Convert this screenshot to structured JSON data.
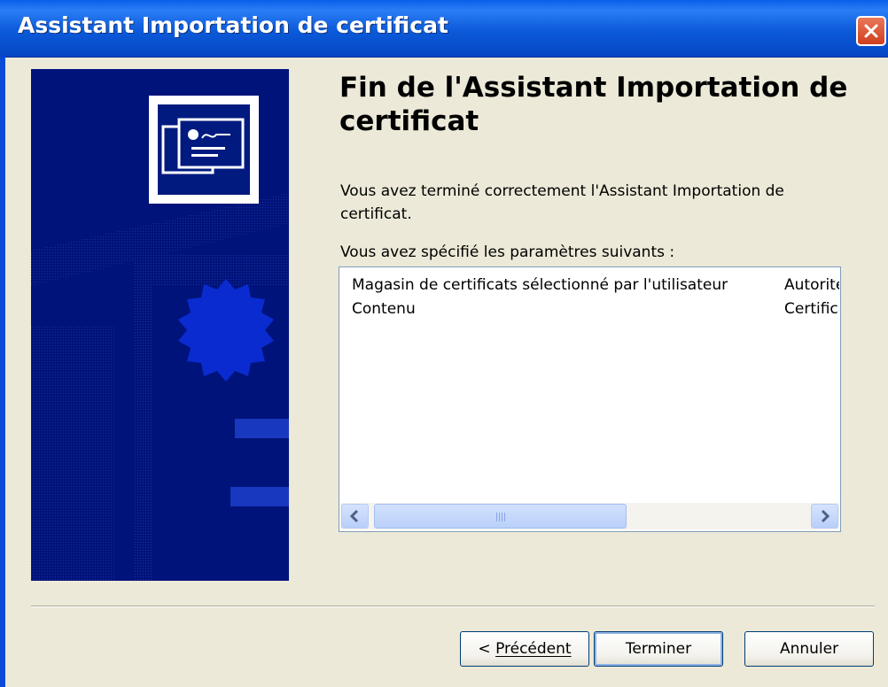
{
  "window": {
    "title": "Assistant Importation de certificat"
  },
  "content": {
    "heading": "Fin de l'Assistant Importation de certificat",
    "description": "Vous avez terminé correctement l'Assistant Importation de certificat.",
    "settings_label": "Vous avez spécifié les paramètres suivants :",
    "settings": [
      {
        "name": "Magasin de certificats sélectionné par l'utilisateur",
        "value": "Autorités de certification racines de confiance"
      },
      {
        "name": "Contenu",
        "value": "Certificat"
      }
    ]
  },
  "buttons": {
    "previous_prefix": "< ",
    "previous_label": "Précédent",
    "finish_label": "Terminer",
    "cancel_label": "Annuler"
  },
  "colors": {
    "titlebar": "#0a5fe8",
    "banner": "#00137a",
    "dialog_bg": "#ece9d8"
  },
  "icons": {
    "close": "close-icon",
    "banner_certificate": "certificate-icon",
    "scroll_left": "arrow-left-icon",
    "scroll_right": "arrow-right-icon"
  }
}
